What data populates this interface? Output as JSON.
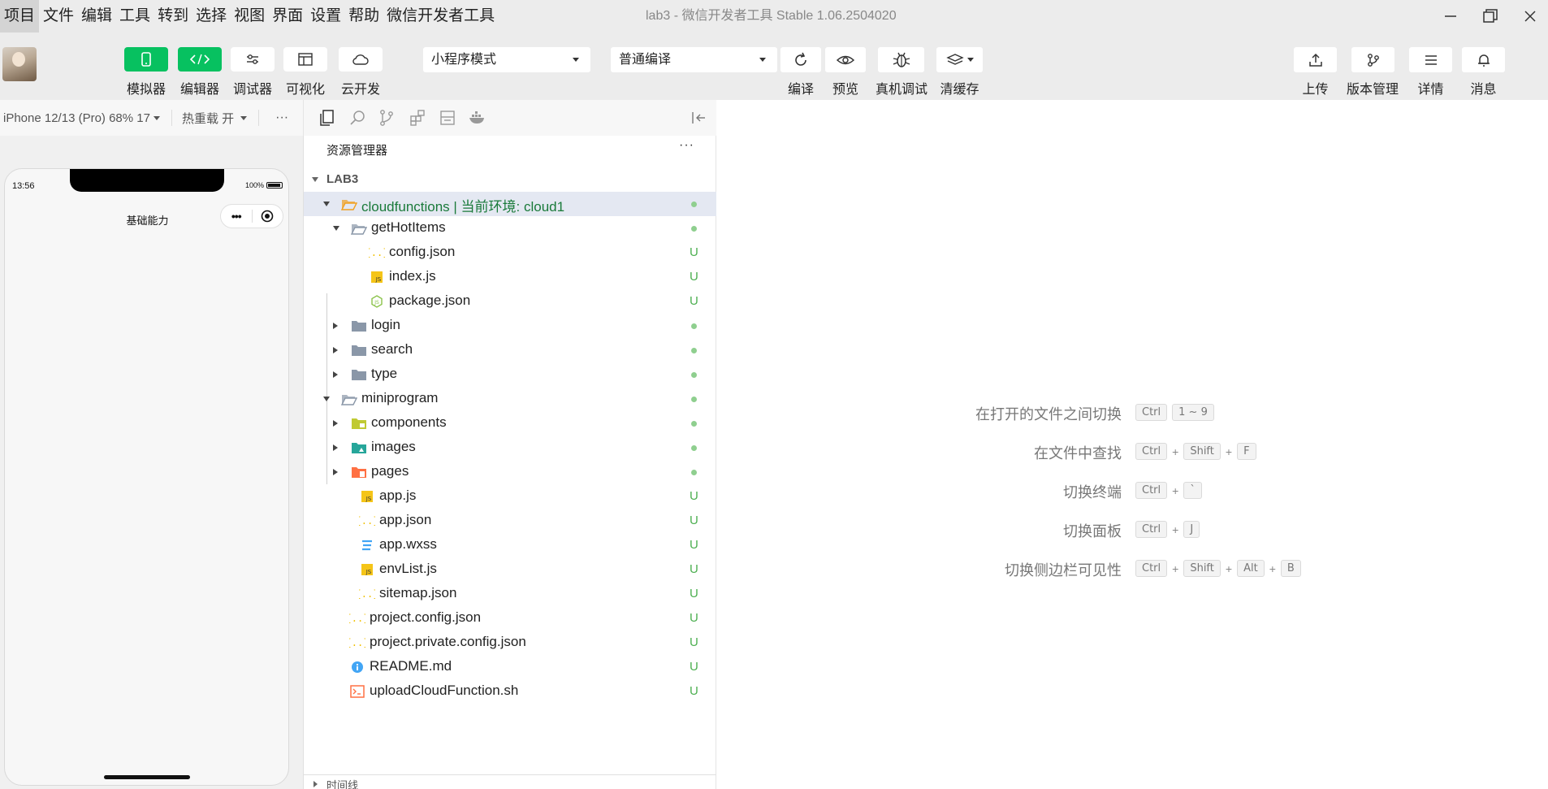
{
  "menu": {
    "items": [
      "项目",
      "文件",
      "编辑",
      "工具",
      "转到",
      "选择",
      "视图",
      "界面",
      "设置",
      "帮助",
      "微信开发者工具"
    ],
    "title": "lab3 - 微信开发者工具 Stable 1.06.2504020"
  },
  "toolbar": {
    "left_buttons": [
      {
        "label": "模拟器",
        "icon": "phone-icon",
        "active": true
      },
      {
        "label": "编辑器",
        "icon": "code-icon",
        "active": true
      },
      {
        "label": "调试器",
        "icon": "sliders-icon",
        "active": false
      },
      {
        "label": "可视化",
        "icon": "layout-icon",
        "active": false
      },
      {
        "label": "云开发",
        "icon": "cloud-icon",
        "active": false
      }
    ],
    "mode_select": "小程序模式",
    "compile_select": "普通编译",
    "center_buttons": [
      {
        "label": "编译",
        "icon": "refresh-icon"
      },
      {
        "label": "预览",
        "icon": "eye-icon"
      },
      {
        "label": "真机调试",
        "icon": "bug-icon"
      },
      {
        "label": "清缓存",
        "icon": "layers-icon"
      }
    ],
    "right_buttons": [
      {
        "label": "上传",
        "icon": "upload-icon"
      },
      {
        "label": "版本管理",
        "icon": "branch-icon"
      },
      {
        "label": "详情",
        "icon": "menu-icon"
      },
      {
        "label": "消息",
        "icon": "bell-icon"
      }
    ]
  },
  "simulator": {
    "device_select": "iPhone 12/13 (Pro) 68% 17",
    "hot_reload": "热重载 开",
    "more": "···",
    "status_time": "13:56",
    "battery": "100%",
    "page_title": "基础能力",
    "capsule_more": "•••"
  },
  "explorer": {
    "header": "资源管理器",
    "more": "···",
    "root": "LAB3",
    "timeline": "时间线",
    "tree": [
      {
        "name": "cloudfunctions | 当前环境: cloud1",
        "depth": 0,
        "type": "folder-open",
        "expanded": true,
        "status": "dot",
        "color": "#f0a020",
        "selected": true
      },
      {
        "name": "getHotItems",
        "depth": 1,
        "type": "folder-open",
        "expanded": true,
        "status": "dot",
        "color": "#8a97a8"
      },
      {
        "name": "config.json",
        "depth": 2,
        "type": "json",
        "status": "U",
        "color": "#f0c000"
      },
      {
        "name": "index.js",
        "depth": 2,
        "type": "js",
        "status": "U",
        "color": "#f5c518"
      },
      {
        "name": "package.json",
        "depth": 2,
        "type": "node",
        "status": "U",
        "color": "#8bc34a"
      },
      {
        "name": "login",
        "depth": 1,
        "type": "folder",
        "expanded": false,
        "status": "dot",
        "color": "#8a97a8"
      },
      {
        "name": "search",
        "depth": 1,
        "type": "folder",
        "expanded": false,
        "status": "dot",
        "color": "#8a97a8"
      },
      {
        "name": "type",
        "depth": 1,
        "type": "folder",
        "expanded": false,
        "status": "dot",
        "color": "#8a97a8"
      },
      {
        "name": "miniprogram",
        "depth": 0,
        "type": "folder-open",
        "expanded": true,
        "status": "dot",
        "color": "#8a97a8"
      },
      {
        "name": "components",
        "depth": 1,
        "type": "folder-comp",
        "expanded": false,
        "status": "dot",
        "color": "#c0ca33"
      },
      {
        "name": "images",
        "depth": 1,
        "type": "folder-img",
        "expanded": false,
        "status": "dot",
        "color": "#26a69a"
      },
      {
        "name": "pages",
        "depth": 1,
        "type": "folder-pages",
        "expanded": false,
        "status": "dot",
        "color": "#ff7043"
      },
      {
        "name": "app.js",
        "depth": 1,
        "type": "js",
        "status": "U",
        "color": "#f5c518"
      },
      {
        "name": "app.json",
        "depth": 1,
        "type": "json",
        "status": "U",
        "color": "#f0c000"
      },
      {
        "name": "app.wxss",
        "depth": 1,
        "type": "css",
        "status": "U",
        "color": "#42a5f5"
      },
      {
        "name": "envList.js",
        "depth": 1,
        "type": "js",
        "status": "U",
        "color": "#f5c518"
      },
      {
        "name": "sitemap.json",
        "depth": 1,
        "type": "json",
        "status": "U",
        "color": "#f0c000"
      },
      {
        "name": "project.config.json",
        "depth": 0,
        "type": "json",
        "status": "U",
        "color": "#f0c000"
      },
      {
        "name": "project.private.config.json",
        "depth": 0,
        "type": "json",
        "status": "U",
        "color": "#f0c000"
      },
      {
        "name": "README.md",
        "depth": 0,
        "type": "info",
        "status": "U",
        "color": "#42a5f5"
      },
      {
        "name": "uploadCloudFunction.sh",
        "depth": 0,
        "type": "shell",
        "status": "U",
        "color": "#ff7043"
      }
    ]
  },
  "editor": {
    "hints": [
      {
        "label": "在打开的文件之间切换",
        "keys": [
          "Ctrl",
          "1 ~ 9"
        ],
        "joiner": ""
      },
      {
        "label": "在文件中查找",
        "keys": [
          "Ctrl",
          "Shift",
          "F"
        ],
        "joiner": "+"
      },
      {
        "label": "切换终端",
        "keys": [
          "Ctrl",
          "`"
        ],
        "joiner": "+"
      },
      {
        "label": "切换面板",
        "keys": [
          "Ctrl",
          "J"
        ],
        "joiner": "+"
      },
      {
        "label": "切换侧边栏可见性",
        "keys": [
          "Ctrl",
          "Shift",
          "Alt",
          "B"
        ],
        "joiner": "+"
      }
    ]
  },
  "colors": {
    "accent_green": "#07c160",
    "status_green": "#4caf50",
    "selection": "#e4e8f2"
  }
}
